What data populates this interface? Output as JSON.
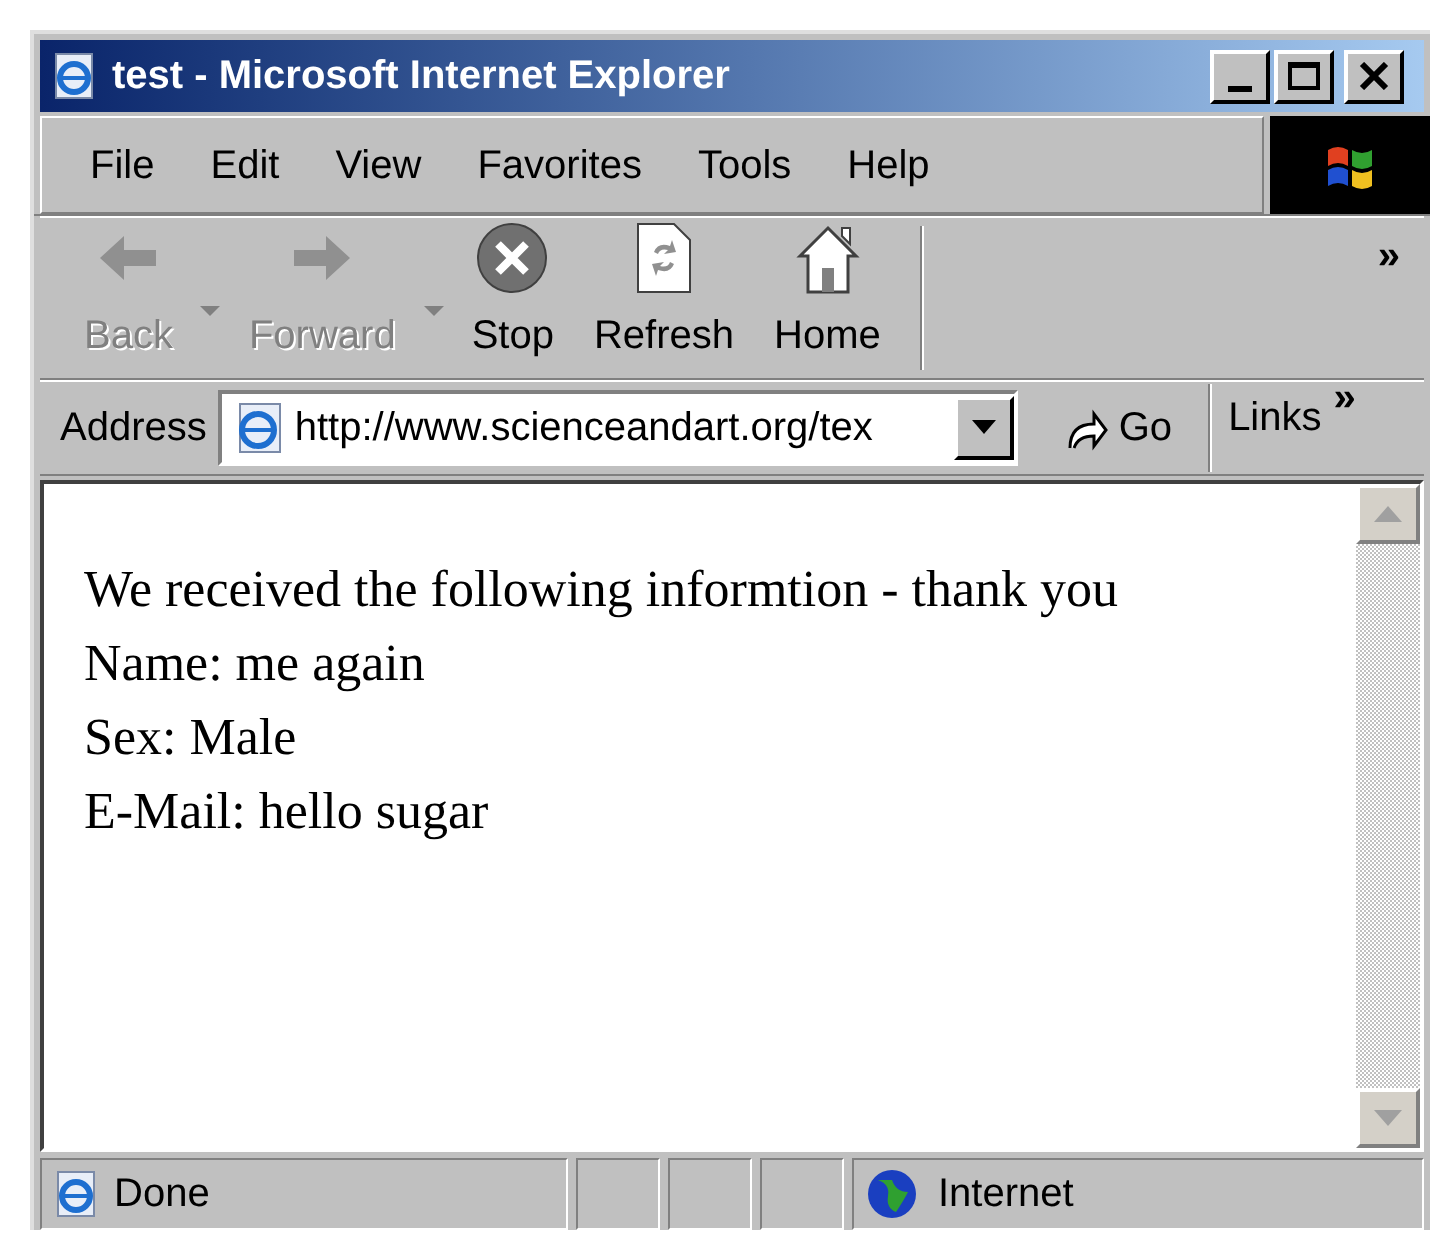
{
  "window": {
    "title": "test - Microsoft Internet Explorer"
  },
  "menu": [
    "File",
    "Edit",
    "View",
    "Favorites",
    "Tools",
    "Help"
  ],
  "toolbar": [
    {
      "kind": "back",
      "label": "Back",
      "disabled": true,
      "has_menu": true
    },
    {
      "kind": "forward",
      "label": "Forward",
      "disabled": true,
      "has_menu": true
    },
    {
      "kind": "stop",
      "label": "Stop",
      "disabled": false,
      "has_menu": false
    },
    {
      "kind": "refresh",
      "label": "Refresh",
      "disabled": false,
      "has_menu": false
    },
    {
      "kind": "home",
      "label": "Home",
      "disabled": false,
      "has_menu": false
    }
  ],
  "toolbar_more": "»",
  "address": {
    "label": "Address",
    "value": "http://www.scienceandart.org/tex",
    "go": "Go",
    "links": "Links",
    "links_more": "»"
  },
  "content": [
    "We received the following informtion - thank you",
    "Name: me again",
    "Sex: Male",
    "E-Mail: hello sugar"
  ],
  "status_bar": {
    "text": "Done",
    "zone": "Internet"
  }
}
